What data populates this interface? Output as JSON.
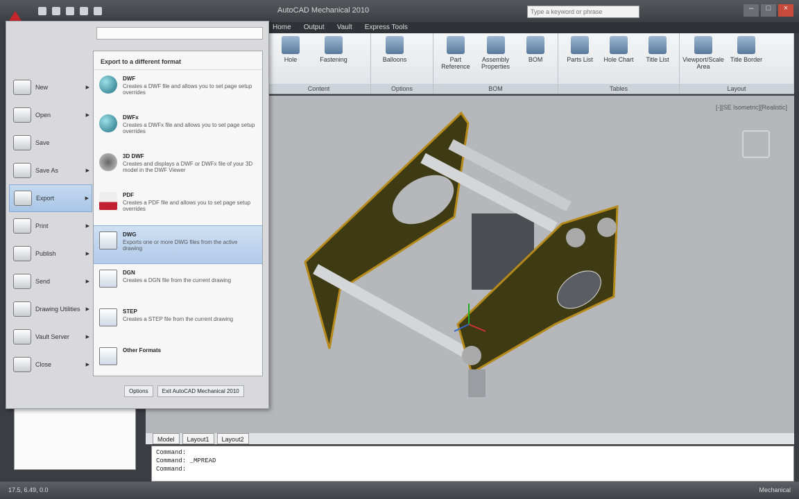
{
  "title_bar": {
    "window_title": "AutoCAD Mechanical 2010",
    "search_placeholder": "Type a keyword or phrase"
  },
  "ribbon": {
    "tabs": [
      "Home",
      "Output",
      "Vault",
      "Express Tools"
    ],
    "panels": [
      {
        "title": "Content",
        "buttons": [
          "Hole",
          "Fastening"
        ]
      },
      {
        "title": "Options",
        "buttons": [
          "Balloons"
        ]
      },
      {
        "title": "BOM",
        "buttons": [
          "Part Reference",
          "Assembly Properties",
          "BOM"
        ]
      },
      {
        "title": "Tables",
        "buttons": [
          "Parts List",
          "Hole Chart",
          "Title List"
        ]
      },
      {
        "title": "Layout",
        "buttons": [
          "Viewport/Scale Area",
          "Title Border"
        ]
      }
    ]
  },
  "viewport": {
    "view_label": "[-][SE Isometric][Realistic]"
  },
  "app_menu": {
    "items": [
      {
        "label": "New"
      },
      {
        "label": "Open"
      },
      {
        "label": "Save"
      },
      {
        "label": "Save As"
      },
      {
        "label": "Export"
      },
      {
        "label": "Print"
      },
      {
        "label": "Publish"
      },
      {
        "label": "Send"
      },
      {
        "label": "Drawing Utilities"
      },
      {
        "label": "Vault Server"
      },
      {
        "label": "Close"
      }
    ],
    "submenu": {
      "heading": "Export to a different format",
      "items": [
        {
          "title": "DWF",
          "desc": "Creates a DWF file and allows you to set page setup overrides"
        },
        {
          "title": "DWFx",
          "desc": "Creates a DWFx file and allows you to set page setup overrides"
        },
        {
          "title": "3D DWF",
          "desc": "Creates and displays a DWF or DWFx file of your 3D model in the DWF Viewer"
        },
        {
          "title": "PDF",
          "desc": "Creates a PDF file and allows you to set page setup overrides"
        },
        {
          "title": "DWG",
          "desc": "Exports one or more DWG files from the active drawing"
        },
        {
          "title": "DGN",
          "desc": "Creates a DGN file from the current drawing"
        },
        {
          "title": "STEP",
          "desc": "Creates a STEP file from the current drawing"
        },
        {
          "title": "Other Formats",
          "desc": ""
        }
      ]
    },
    "buttons": [
      "Options",
      "Exit AutoCAD Mechanical 2010"
    ]
  },
  "layout_tabs": [
    "Model",
    "Layout1",
    "Layout2"
  ],
  "command_line": [
    "Command:",
    "Command: _MPREAD",
    "Command:"
  ],
  "status": {
    "coords": "17.5, 6.49, 0.0",
    "workspace": "Mechanical"
  }
}
